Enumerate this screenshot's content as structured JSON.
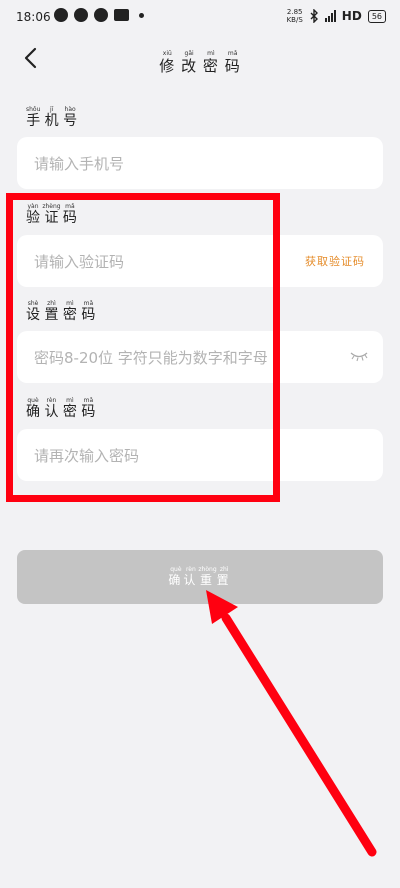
{
  "status_bar": {
    "time": "18:06",
    "speed_value": "2.85",
    "speed_unit": "KB/S",
    "network": "HD",
    "battery": "56"
  },
  "header": {
    "title": "修改密码",
    "title_pinyin": [
      "xiū",
      "gǎi",
      "mì",
      "mǎ"
    ],
    "title_chars": [
      "修",
      "改",
      "密",
      "码"
    ]
  },
  "form": {
    "phone": {
      "label_chars": [
        "手",
        "机",
        "号"
      ],
      "label_pinyin": [
        "shǒu",
        "jī",
        "hào"
      ],
      "placeholder": "请输入手机号"
    },
    "code": {
      "label_chars": [
        "验",
        "证",
        "码"
      ],
      "label_pinyin": [
        "yàn",
        "zhèng",
        "mǎ"
      ],
      "placeholder": "请输入验证码",
      "get_code_label": "获取验证码"
    },
    "password": {
      "label_chars": [
        "设",
        "置",
        "密",
        "码"
      ],
      "label_pinyin": [
        "shè",
        "zhì",
        "mì",
        "mǎ"
      ],
      "placeholder": "密码8-20位 字符只能为数字和字母"
    },
    "confirm": {
      "label_chars": [
        "确",
        "认",
        "密",
        "码"
      ],
      "label_pinyin": [
        "què",
        "rèn",
        "mì",
        "mǎ"
      ],
      "placeholder": "请再次输入密码"
    }
  },
  "submit": {
    "chars": [
      "确",
      "认",
      "重",
      "置"
    ],
    "pinyin": [
      "què",
      "rèn",
      "zhòng",
      "zhì"
    ]
  },
  "annotation": {
    "box_color": "#ff0010",
    "arrow_color": "#ff0010"
  }
}
